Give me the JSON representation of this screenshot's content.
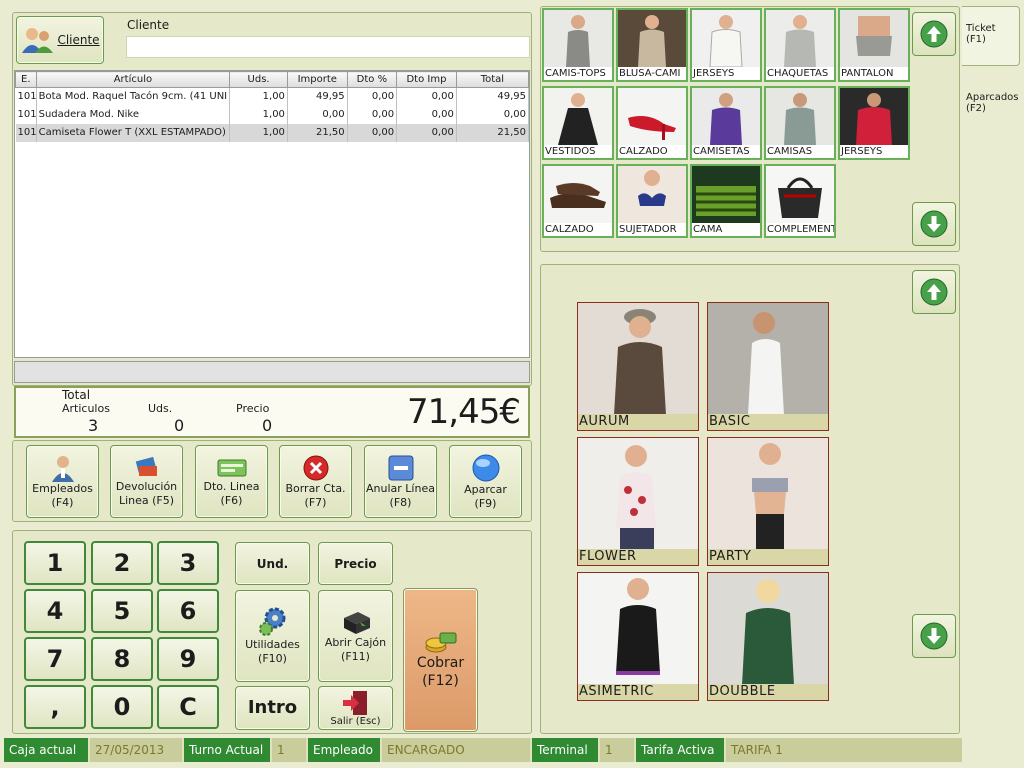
{
  "client": {
    "button_label": "Cliente",
    "field_label": "Cliente",
    "value": ""
  },
  "lines_table": {
    "headers": [
      "E.",
      "Artículo",
      "Uds.",
      "Importe",
      "Dto %",
      "Dto Imp",
      "Total"
    ],
    "rows": [
      [
        "101",
        "Bota Mod. Raquel Tacón 9cm. (41 UNI",
        "1,00",
        "49,95",
        "0,00",
        "0,00",
        "49,95"
      ],
      [
        "101",
        "Sudadera Mod. Nike",
        "1,00",
        "0,00",
        "0,00",
        "0,00",
        "0,00"
      ],
      [
        "101",
        "Camiseta Flower T (XXL ESTAMPADO)",
        "1,00",
        "21,50",
        "0,00",
        "0,00",
        "21,50"
      ]
    ]
  },
  "totals": {
    "articles_label_1": "Total",
    "articles_label_2": "Articulos",
    "articles_value": "3",
    "units_label": "Uds.",
    "units_value": "0",
    "price_label": "Precio",
    "price_value": "0",
    "grand_total": "71,45€"
  },
  "actions": [
    {
      "line1": "Empleados",
      "line2": "(F4)",
      "icon": "employees-icon"
    },
    {
      "line1": "Devolución",
      "line2": "Linea (F5)",
      "icon": "return-icon"
    },
    {
      "line1": "Dto. Linea",
      "line2": "(F6)",
      "icon": "discount-icon"
    },
    {
      "line1": "Borrar Cta.",
      "line2": "(F7)",
      "icon": "delete-icon"
    },
    {
      "line1": "Anular Línea",
      "line2": "(F8)",
      "icon": "cancel-line-icon"
    },
    {
      "line1": "Aparcar",
      "line2": "(F9)",
      "icon": "park-icon"
    }
  ],
  "keypad": {
    "keys": [
      "1",
      "2",
      "3",
      "4",
      "5",
      "6",
      "7",
      "8",
      "9",
      ",",
      "0",
      "C"
    ],
    "und": "Und.",
    "precio": "Precio",
    "utilidades_1": "Utilidades",
    "utilidades_2": "(F10)",
    "cajon_1": "Abrir Cajón",
    "cajon_2": "(F11)",
    "intro": "Intro",
    "salir": "Salir (Esc)",
    "cobrar_1": "Cobrar",
    "cobrar_2": "(F12)"
  },
  "categories": [
    "CAMIS-TOPS",
    "BLUSA-CAMI",
    "JERSEYS",
    "CHAQUETAS",
    "PANTALON",
    "VESTIDOS",
    "CALZADO",
    "CAMISETAS",
    "CAMISAS",
    "JERSEYS",
    "CALZADO",
    "SUJETADOR",
    "CAMA",
    "COMPLEMENTOS"
  ],
  "products": [
    "AURUM",
    "BASIC",
    "FLOWER",
    "PARTY",
    "ASIMETRIC",
    "DOUBBLE"
  ],
  "tabs": {
    "ticket_1": "Ticket",
    "ticket_2": "(F1)",
    "aparcados_1": "Aparcados",
    "aparcados_2": "(F2)"
  },
  "status": {
    "caja_label": "Caja actual",
    "caja_value": "27/05/2013",
    "turno_label": "Turno Actual",
    "turno_value": "1",
    "empleado_label": "Empleado",
    "empleado_value": "ENCARGADO",
    "terminal_label": "Terminal",
    "terminal_value": "1",
    "tarifa_label": "Tarifa Activa",
    "tarifa_value": "TARIFA 1"
  },
  "colors": {
    "accent_green": "#2f8a32",
    "cobrar_orange": "#e5a878",
    "panel": "#e6e9c9"
  }
}
